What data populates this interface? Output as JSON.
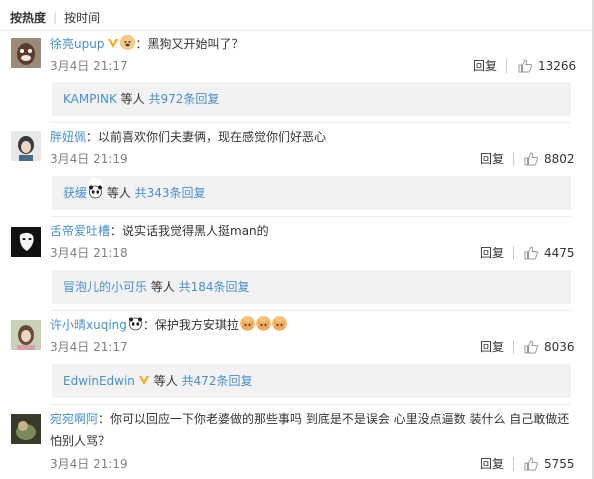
{
  "sort": {
    "hot": "按热度",
    "time": "按时间"
  },
  "comments": [
    {
      "user": "徐亮upup",
      "badges": [
        "v-badge",
        "dog-emoji"
      ],
      "text": "：黑狗又开始叫了？",
      "time": "3月4日 21:17",
      "reply": "回复",
      "likes": "13266",
      "sub": {
        "names": "KAMPINK",
        "mid": " 等人 ",
        "count": "共972条回复"
      }
    },
    {
      "user": "胖妞佩",
      "text": "：以前喜欢你们夫妻俩，现在感觉你们好恶心",
      "time": "3月4日 21:19",
      "reply": "回复",
      "likes": "8802",
      "sub": {
        "names": "获缓",
        "mid": " 等人 ",
        "count": "共343条回复"
      }
    },
    {
      "user": "舌帝爱吐槽",
      "text": "：说实话我觉得黑人挺man的",
      "time": "3月4日 21:18",
      "reply": "回复",
      "likes": "4475",
      "sub": {
        "names": "冒泡儿的小可乐",
        "mid": " 等人 ",
        "count": "共184条回复"
      }
    },
    {
      "user": "许小晴xuqing",
      "text": "：保护我方安琪拉",
      "time": "3月4日 21:17",
      "reply": "回复",
      "likes": "8036",
      "sub": {
        "names": "EdwinEdwin",
        "mid": " 等人 ",
        "count": "共472条回复"
      }
    },
    {
      "user": "宛宛啊阿",
      "text": "：你可以回应一下你老婆做的那些事吗 到底是不是误会 心里没点逼数 装什么 自己敢做还",
      "text2": "怕别人骂？",
      "time": "3月4日 21:19",
      "reply": "回复",
      "likes": "5755"
    }
  ],
  "colors": {
    "link": "#4a8fc8",
    "time": "#808080",
    "sub_bg": "#f2f2f5"
  }
}
